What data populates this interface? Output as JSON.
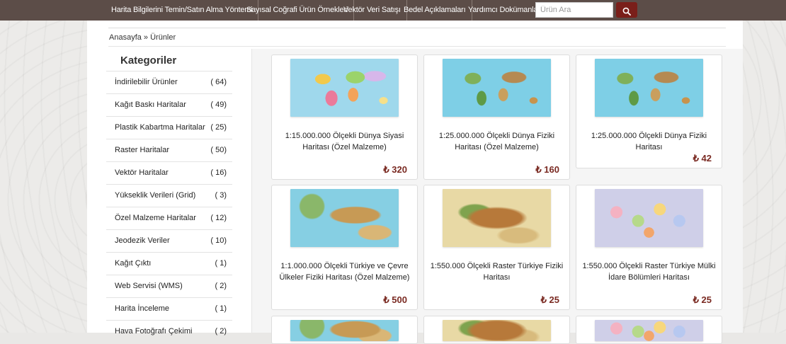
{
  "nav": {
    "links": [
      "Harita Bilgilerini Temin/Satın Alma Yöntemi",
      "Sayısal Coğrafi Ürün Örnekleri",
      "Vektör Veri Satışı",
      "Bedel Açıklamaları",
      "Yardımcı Dokümanlar"
    ],
    "search_placeholder": "Ürün Ara",
    "search_icon": "search-icon"
  },
  "breadcrumb": {
    "text": "Anasayfa » Ürünler"
  },
  "sidebar": {
    "title": "Kategoriler",
    "categories": [
      {
        "label": "İndirilebilir Ürünler",
        "count": "( 64)"
      },
      {
        "label": "Kağıt Baskı Haritalar",
        "count": "( 49)"
      },
      {
        "label": "Plastik Kabartma Haritalar",
        "count": "( 25)"
      },
      {
        "label": "Raster Haritalar",
        "count": "( 50)"
      },
      {
        "label": "Vektör Haritalar",
        "count": "( 16)"
      },
      {
        "label": "Yükseklik Verileri (Grid)",
        "count": "( 3)"
      },
      {
        "label": "Özel Malzeme Haritalar",
        "count": "( 12)"
      },
      {
        "label": "Jeodezik Veriler",
        "count": "( 10)"
      },
      {
        "label": "Kağıt Çıktı",
        "count": "( 1)"
      },
      {
        "label": "Web Servisi (WMS)",
        "count": "( 2)"
      },
      {
        "label": "Harita İnceleme",
        "count": "( 1)"
      },
      {
        "label": "Hava Fotoğrafı Çekimi",
        "count": "( 2)"
      }
    ]
  },
  "products": [
    {
      "title": "1:15.000.000 Ölçekli Dünya Siyasi Haritası (Özel Malzeme)",
      "price": "₺ 320",
      "thumb": "world-political-map"
    },
    {
      "title": "1:25.000.000 Ölçekli Dünya Fiziki Haritası (Özel Malzeme)",
      "price": "₺ 160",
      "thumb": "world-physical-map"
    },
    {
      "title": "1:25.000.000 Ölçekli Dünya Fiziki Haritası",
      "price": "₺ 42",
      "thumb": "world-physical-map"
    },
    {
      "title": "1:1.000.000 Ölçekli Türkiye ve Çevre Ülkeler Fiziki Haritası (Özel Malzeme)",
      "price": "₺ 500",
      "thumb": "turkey-region-physical-map"
    },
    {
      "title": "1:550.000 Ölçekli Raster Türkiye Fiziki Haritası",
      "price": "₺ 25",
      "thumb": "turkey-physical-map"
    },
    {
      "title": "1:550.000 Ölçekli Raster Türkiye Mülki İdare Bölümleri Haritası",
      "price": "₺ 25",
      "thumb": "turkey-administrative-map"
    }
  ],
  "colors": {
    "nav_bg": "#5c4d48",
    "search_button": "#7a1f1a",
    "price": "#7a2a22"
  }
}
